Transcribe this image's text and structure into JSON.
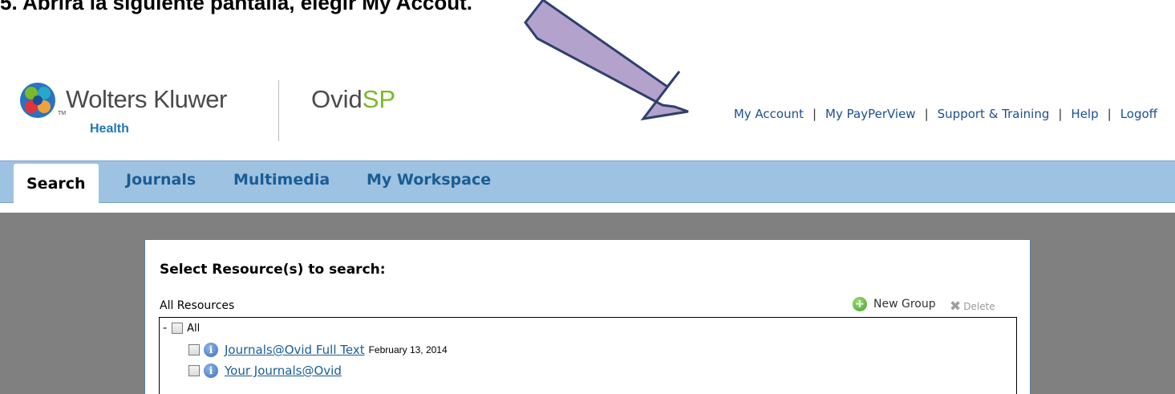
{
  "instruction": "5.  Abrirá la siguiente pantalla, elegir My Accout.",
  "header": {
    "brand": "Wolters Kluwer",
    "brand_sub": "Health",
    "trademark": "TM",
    "product_main": "Ovid",
    "product_accent": "SP",
    "links": [
      "My Account",
      "My PayPerView",
      "Support & Training",
      "Help",
      "Logoff"
    ]
  },
  "tabs": [
    "Search",
    "Journals",
    "Multimedia",
    "My Workspace"
  ],
  "panel": {
    "title": "Select Resource(s) to search:",
    "section_label": "All Resources",
    "new_group_label": "New Group",
    "delete_label": "Delete",
    "tree_root": {
      "toggle": "-",
      "label": "All"
    },
    "resources": [
      {
        "name": "Journals@Ovid Full Text",
        "date": "February 13, 2014"
      },
      {
        "name": "Your Journals@Ovid",
        "date": ""
      }
    ]
  },
  "colors": {
    "tab_bar": "#9ec2e2",
    "link_blue": "#1a5d94",
    "arrow_fill": "#b3a2cc",
    "arrow_stroke": "#2f3f6e",
    "main_bg": "#808080"
  },
  "icons": [
    "wolters-kluwer-globe-icon",
    "plus-circle-icon",
    "delete-x-icon",
    "info-icon",
    "arrow-annotation"
  ]
}
